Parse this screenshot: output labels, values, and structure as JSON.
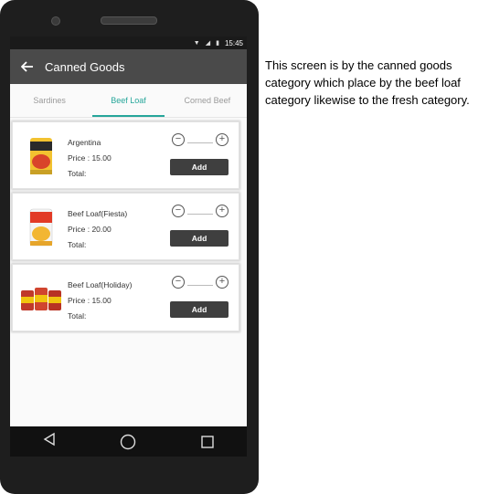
{
  "status": {
    "time": "15:45"
  },
  "appbar": {
    "title": "Canned Goods"
  },
  "tabs": [
    {
      "label": "Sardines",
      "active": false
    },
    {
      "label": "Beef Loaf",
      "active": true
    },
    {
      "label": "Corned Beef",
      "active": false
    }
  ],
  "products": [
    {
      "name": "Argentina",
      "price": "Price : 15.00",
      "total": "Total:",
      "add": "Add",
      "minus": "−",
      "plus": "+",
      "image": "can-image"
    },
    {
      "name": "Beef Loaf(Fiesta)",
      "price": "Price : 20.00",
      "total": "Total:",
      "add": "Add",
      "minus": "−",
      "plus": "+",
      "image": "can-image"
    },
    {
      "name": "Beef Loaf(Holiday)",
      "price": "Price : 15.00",
      "total": "Total:",
      "add": "Add",
      "minus": "−",
      "plus": "+",
      "image": "cans-group-image"
    }
  ],
  "caption": "This screen is by the canned goods category which place by the beef loaf category likewise to the fresh category.",
  "colors": {
    "accent": "#26a69a",
    "appbar": "#4a4a4a",
    "button": "#3f3f3f"
  }
}
